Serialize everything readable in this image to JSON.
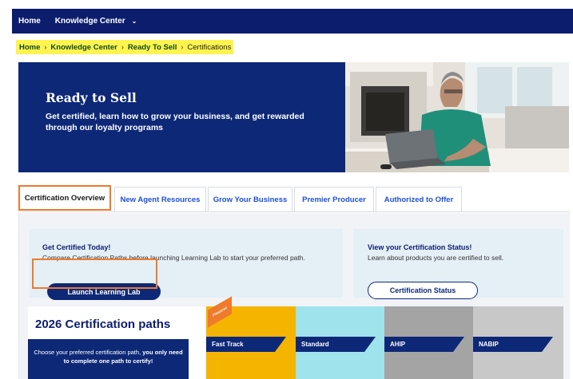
{
  "topnav": {
    "home": "Home",
    "knowledge_center": "Knowledge Center",
    "chevron": "⌄",
    "bg": "#0d1d6e"
  },
  "breadcrumb": {
    "items": [
      "Home",
      "Knowledge Center",
      "Ready To Sell"
    ],
    "current": "Certifications",
    "separator": "›",
    "highlight": "#fff44f"
  },
  "hero": {
    "title": "Ready to Sell",
    "subtitle": "Get certified, learn how to grow your business, and get rewarded through our loyalty programs",
    "bg": "#0d2877"
  },
  "tabs": [
    {
      "label": "Certification Overview",
      "active": true
    },
    {
      "label": "New Agent Resources",
      "active": false
    },
    {
      "label": "Grow Your Business",
      "active": false
    },
    {
      "label": "Premier Producer",
      "active": false
    },
    {
      "label": "Authorized to Offer",
      "active": false
    }
  ],
  "get_certified": {
    "title": "Get Certified Today!",
    "description": "Compare Certification Paths before launching Learning Lab to start your preferred path.",
    "button": "Launch Learning Lab"
  },
  "status_card": {
    "title": "View your Certification Status!",
    "description": "Learn about products you are certified to sell.",
    "button": "Certification Status"
  },
  "paths": {
    "title": "2026 Certification paths",
    "note_prefix": "Choose your preferred certification path, ",
    "note_bold": "you only need to complete one path to certify!",
    "ribbon": "Fastest",
    "options": [
      {
        "label": "Fast Track",
        "color": "#f4b400"
      },
      {
        "label": "Standard",
        "color": "#9fe3ec"
      },
      {
        "label": "AHIP",
        "color": "#a4a4a4"
      },
      {
        "label": "NABIP",
        "color": "#c8c8c8"
      }
    ]
  },
  "accent": "#ef7a2b"
}
